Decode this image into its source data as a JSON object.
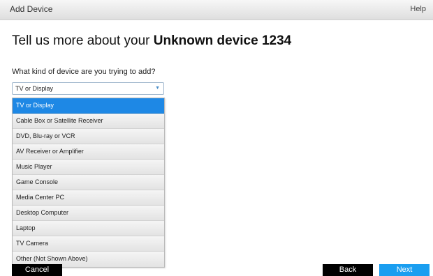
{
  "header": {
    "title": "Add Device",
    "help_label": "Help"
  },
  "main": {
    "heading_prefix": "Tell us more about your ",
    "heading_device": "Unknown device 1234",
    "question": "What kind of device are you trying to add?",
    "select": {
      "selected_value": "TV or Display",
      "options": [
        "TV or Display",
        "Cable Box or Satellite Receiver",
        "DVD, Blu-ray or VCR",
        "AV Receiver or Amplifier",
        "Music Player",
        "Game Console",
        "Media Center PC",
        "Desktop Computer",
        "Laptop",
        "TV Camera",
        "Other (Not Shown Above)"
      ],
      "highlighted_index": 0
    }
  },
  "footer": {
    "cancel_label": "Cancel",
    "back_label": "Back",
    "next_label": "Next"
  },
  "colors": {
    "accent": "#1e88e5",
    "next_button": "#1a9ef0",
    "dark_button": "#000000"
  },
  "icons": {
    "select_caret": "chevron-down-icon"
  }
}
